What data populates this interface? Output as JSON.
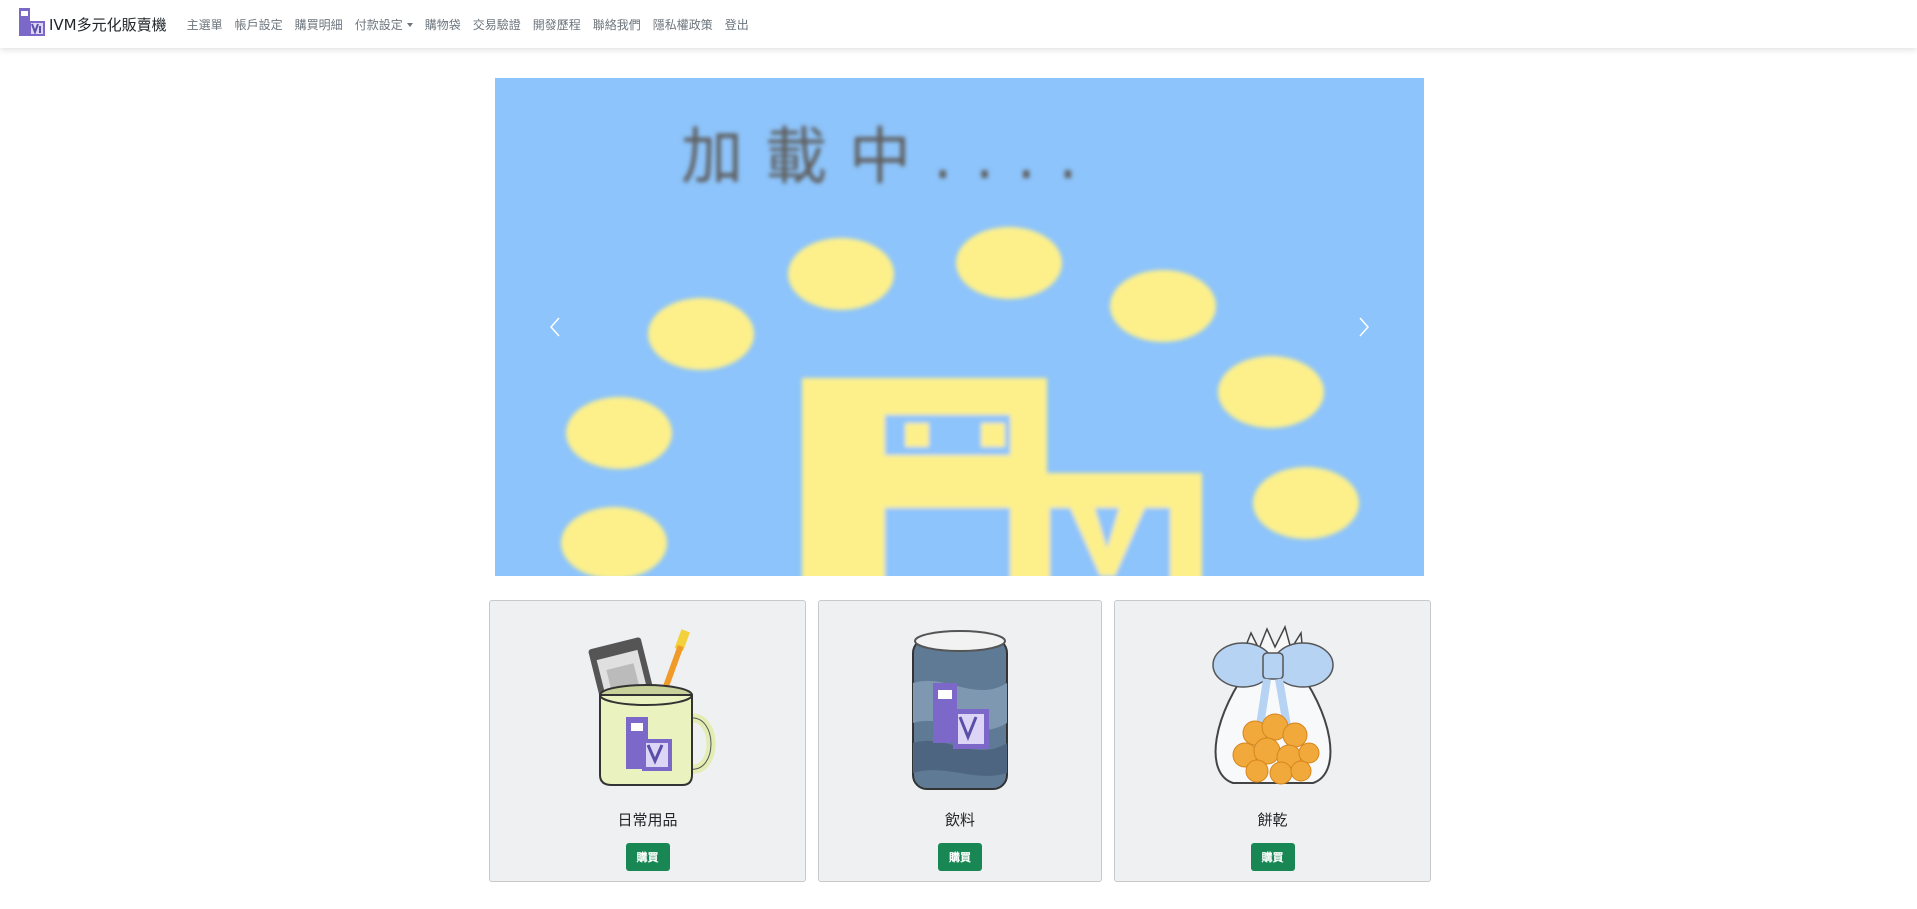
{
  "navbar": {
    "brand": "IVM多元化販賣機",
    "items": [
      {
        "label": "主選單"
      },
      {
        "label": "帳戶設定"
      },
      {
        "label": "購買明細"
      },
      {
        "label": "付款設定",
        "dropdown": true
      },
      {
        "label": "購物袋"
      },
      {
        "label": "交易驗證"
      },
      {
        "label": "開發歷程"
      },
      {
        "label": "聯絡我們"
      },
      {
        "label": "隱私權政策"
      },
      {
        "label": "登出"
      }
    ]
  },
  "carousel": {
    "slide_text": "加載中....",
    "prev_icon": "chevron-left-icon",
    "next_icon": "chevron-right-icon",
    "colors": {
      "sky": "#8dc4fb",
      "dots": "#fdf08b",
      "text": "#5f5f5f"
    }
  },
  "products": [
    {
      "name": "日常用品",
      "button": "購買",
      "icon": "mug-icon"
    },
    {
      "name": "飲料",
      "button": "購買",
      "icon": "can-icon"
    },
    {
      "name": "餅乾",
      "button": "購買",
      "icon": "cookie-bag-icon"
    }
  ],
  "colors": {
    "buy_button": "#198754",
    "card_bg": "#eff0f2"
  }
}
